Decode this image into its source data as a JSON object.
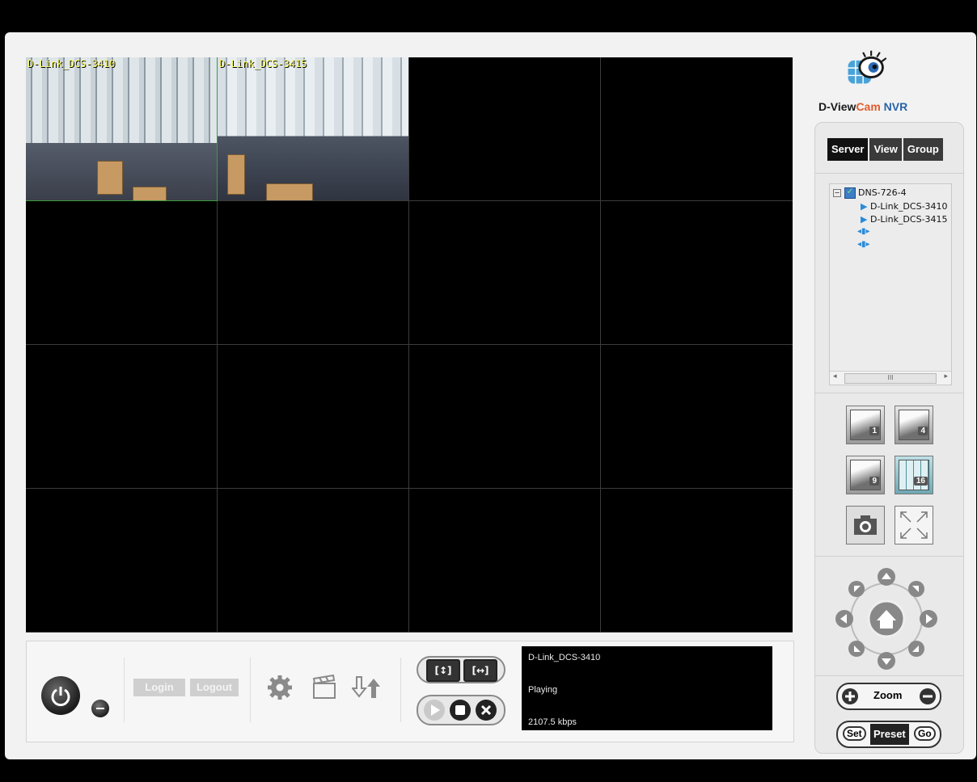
{
  "app": {
    "name": "D-ViewCam NVR",
    "logo_part1": "D-View",
    "logo_part2": "Cam",
    "logo_part3": " NVR"
  },
  "grid": {
    "cells": [
      {
        "label": "D-Link_DCS-3410",
        "has_video": true,
        "selected": true
      },
      {
        "label": "D-Link_DCS-3415",
        "has_video": true,
        "selected": false
      },
      {
        "label": "",
        "has_video": false
      },
      {
        "label": "",
        "has_video": false
      },
      {
        "label": "",
        "has_video": false
      },
      {
        "label": "",
        "has_video": false
      },
      {
        "label": "",
        "has_video": false
      },
      {
        "label": "",
        "has_video": false
      },
      {
        "label": "",
        "has_video": false
      },
      {
        "label": "",
        "has_video": false
      },
      {
        "label": "",
        "has_video": false
      },
      {
        "label": "",
        "has_video": false
      },
      {
        "label": "",
        "has_video": false
      },
      {
        "label": "",
        "has_video": false
      },
      {
        "label": "",
        "has_video": false
      },
      {
        "label": "",
        "has_video": false
      }
    ]
  },
  "toolbar": {
    "login_label": "Login",
    "logout_label": "Logout",
    "icons": [
      "power-icon",
      "minimize-icon",
      "settings-icon",
      "playback-icon",
      "import-export-icon"
    ]
  },
  "status": {
    "camera": "D-Link_DCS-3410",
    "state": "Playing",
    "bitrate": "2107.5 kbps"
  },
  "sidebar": {
    "tabs": [
      {
        "label": "Server",
        "active": true
      },
      {
        "label": "View",
        "active": false
      },
      {
        "label": "Group",
        "active": false
      }
    ],
    "tree": {
      "root": "DNS-726-4",
      "cameras": [
        "D-Link_DCS-3410",
        "D-Link_DCS-3415"
      ],
      "scrollbar_label": "III"
    },
    "layout_buttons": [
      "1",
      "4",
      "9",
      "16"
    ],
    "zoom_label": "Zoom",
    "preset": {
      "set": "Set",
      "label": "Preset",
      "go": "Go"
    }
  },
  "colors": {
    "accent_orange": "#e25c2c",
    "accent_blue": "#2764a8",
    "label_yellow": "#ffff66",
    "selection_green": "#3e9a3e"
  }
}
